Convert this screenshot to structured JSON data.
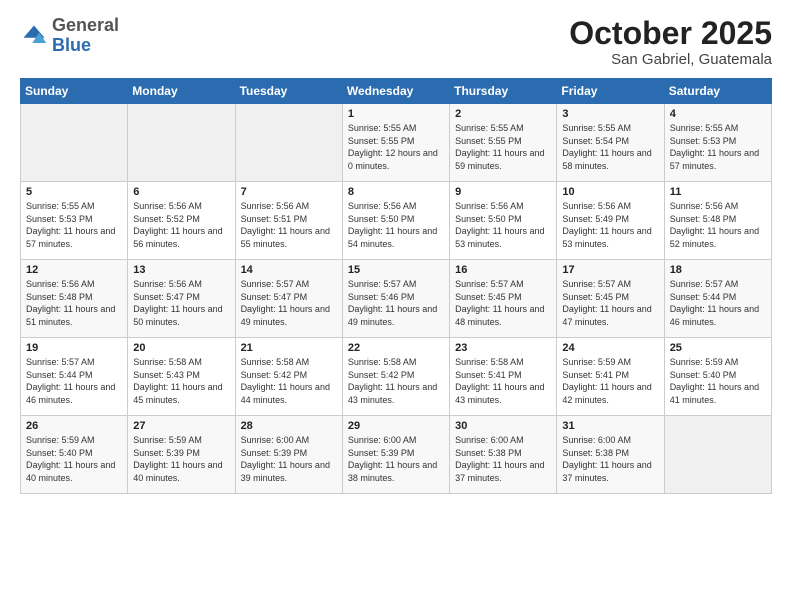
{
  "header": {
    "logo_general": "General",
    "logo_blue": "Blue",
    "month_year": "October 2025",
    "location": "San Gabriel, Guatemala"
  },
  "days_of_week": [
    "Sunday",
    "Monday",
    "Tuesday",
    "Wednesday",
    "Thursday",
    "Friday",
    "Saturday"
  ],
  "weeks": [
    [
      {
        "day": "",
        "sunrise": "",
        "sunset": "",
        "daylight": ""
      },
      {
        "day": "",
        "sunrise": "",
        "sunset": "",
        "daylight": ""
      },
      {
        "day": "",
        "sunrise": "",
        "sunset": "",
        "daylight": ""
      },
      {
        "day": "1",
        "sunrise": "Sunrise: 5:55 AM",
        "sunset": "Sunset: 5:55 PM",
        "daylight": "Daylight: 12 hours and 0 minutes."
      },
      {
        "day": "2",
        "sunrise": "Sunrise: 5:55 AM",
        "sunset": "Sunset: 5:55 PM",
        "daylight": "Daylight: 11 hours and 59 minutes."
      },
      {
        "day": "3",
        "sunrise": "Sunrise: 5:55 AM",
        "sunset": "Sunset: 5:54 PM",
        "daylight": "Daylight: 11 hours and 58 minutes."
      },
      {
        "day": "4",
        "sunrise": "Sunrise: 5:55 AM",
        "sunset": "Sunset: 5:53 PM",
        "daylight": "Daylight: 11 hours and 57 minutes."
      }
    ],
    [
      {
        "day": "5",
        "sunrise": "Sunrise: 5:55 AM",
        "sunset": "Sunset: 5:53 PM",
        "daylight": "Daylight: 11 hours and 57 minutes."
      },
      {
        "day": "6",
        "sunrise": "Sunrise: 5:56 AM",
        "sunset": "Sunset: 5:52 PM",
        "daylight": "Daylight: 11 hours and 56 minutes."
      },
      {
        "day": "7",
        "sunrise": "Sunrise: 5:56 AM",
        "sunset": "Sunset: 5:51 PM",
        "daylight": "Daylight: 11 hours and 55 minutes."
      },
      {
        "day": "8",
        "sunrise": "Sunrise: 5:56 AM",
        "sunset": "Sunset: 5:50 PM",
        "daylight": "Daylight: 11 hours and 54 minutes."
      },
      {
        "day": "9",
        "sunrise": "Sunrise: 5:56 AM",
        "sunset": "Sunset: 5:50 PM",
        "daylight": "Daylight: 11 hours and 53 minutes."
      },
      {
        "day": "10",
        "sunrise": "Sunrise: 5:56 AM",
        "sunset": "Sunset: 5:49 PM",
        "daylight": "Daylight: 11 hours and 53 minutes."
      },
      {
        "day": "11",
        "sunrise": "Sunrise: 5:56 AM",
        "sunset": "Sunset: 5:48 PM",
        "daylight": "Daylight: 11 hours and 52 minutes."
      }
    ],
    [
      {
        "day": "12",
        "sunrise": "Sunrise: 5:56 AM",
        "sunset": "Sunset: 5:48 PM",
        "daylight": "Daylight: 11 hours and 51 minutes."
      },
      {
        "day": "13",
        "sunrise": "Sunrise: 5:56 AM",
        "sunset": "Sunset: 5:47 PM",
        "daylight": "Daylight: 11 hours and 50 minutes."
      },
      {
        "day": "14",
        "sunrise": "Sunrise: 5:57 AM",
        "sunset": "Sunset: 5:47 PM",
        "daylight": "Daylight: 11 hours and 49 minutes."
      },
      {
        "day": "15",
        "sunrise": "Sunrise: 5:57 AM",
        "sunset": "Sunset: 5:46 PM",
        "daylight": "Daylight: 11 hours and 49 minutes."
      },
      {
        "day": "16",
        "sunrise": "Sunrise: 5:57 AM",
        "sunset": "Sunset: 5:45 PM",
        "daylight": "Daylight: 11 hours and 48 minutes."
      },
      {
        "day": "17",
        "sunrise": "Sunrise: 5:57 AM",
        "sunset": "Sunset: 5:45 PM",
        "daylight": "Daylight: 11 hours and 47 minutes."
      },
      {
        "day": "18",
        "sunrise": "Sunrise: 5:57 AM",
        "sunset": "Sunset: 5:44 PM",
        "daylight": "Daylight: 11 hours and 46 minutes."
      }
    ],
    [
      {
        "day": "19",
        "sunrise": "Sunrise: 5:57 AM",
        "sunset": "Sunset: 5:44 PM",
        "daylight": "Daylight: 11 hours and 46 minutes."
      },
      {
        "day": "20",
        "sunrise": "Sunrise: 5:58 AM",
        "sunset": "Sunset: 5:43 PM",
        "daylight": "Daylight: 11 hours and 45 minutes."
      },
      {
        "day": "21",
        "sunrise": "Sunrise: 5:58 AM",
        "sunset": "Sunset: 5:42 PM",
        "daylight": "Daylight: 11 hours and 44 minutes."
      },
      {
        "day": "22",
        "sunrise": "Sunrise: 5:58 AM",
        "sunset": "Sunset: 5:42 PM",
        "daylight": "Daylight: 11 hours and 43 minutes."
      },
      {
        "day": "23",
        "sunrise": "Sunrise: 5:58 AM",
        "sunset": "Sunset: 5:41 PM",
        "daylight": "Daylight: 11 hours and 43 minutes."
      },
      {
        "day": "24",
        "sunrise": "Sunrise: 5:59 AM",
        "sunset": "Sunset: 5:41 PM",
        "daylight": "Daylight: 11 hours and 42 minutes."
      },
      {
        "day": "25",
        "sunrise": "Sunrise: 5:59 AM",
        "sunset": "Sunset: 5:40 PM",
        "daylight": "Daylight: 11 hours and 41 minutes."
      }
    ],
    [
      {
        "day": "26",
        "sunrise": "Sunrise: 5:59 AM",
        "sunset": "Sunset: 5:40 PM",
        "daylight": "Daylight: 11 hours and 40 minutes."
      },
      {
        "day": "27",
        "sunrise": "Sunrise: 5:59 AM",
        "sunset": "Sunset: 5:39 PM",
        "daylight": "Daylight: 11 hours and 40 minutes."
      },
      {
        "day": "28",
        "sunrise": "Sunrise: 6:00 AM",
        "sunset": "Sunset: 5:39 PM",
        "daylight": "Daylight: 11 hours and 39 minutes."
      },
      {
        "day": "29",
        "sunrise": "Sunrise: 6:00 AM",
        "sunset": "Sunset: 5:39 PM",
        "daylight": "Daylight: 11 hours and 38 minutes."
      },
      {
        "day": "30",
        "sunrise": "Sunrise: 6:00 AM",
        "sunset": "Sunset: 5:38 PM",
        "daylight": "Daylight: 11 hours and 37 minutes."
      },
      {
        "day": "31",
        "sunrise": "Sunrise: 6:00 AM",
        "sunset": "Sunset: 5:38 PM",
        "daylight": "Daylight: 11 hours and 37 minutes."
      },
      {
        "day": "",
        "sunrise": "",
        "sunset": "",
        "daylight": ""
      }
    ]
  ]
}
